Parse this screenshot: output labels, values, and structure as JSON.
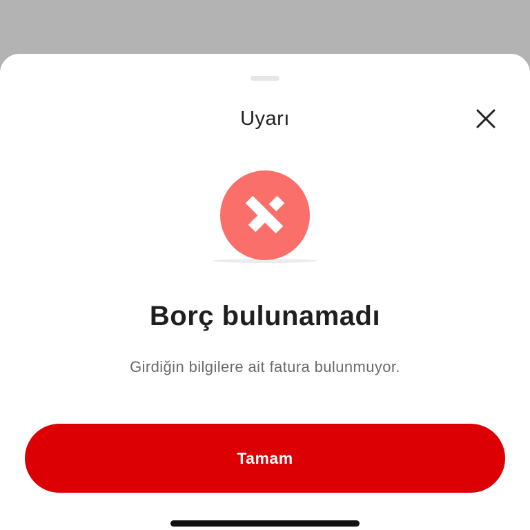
{
  "sheet": {
    "title": "Uyarı",
    "close_icon": "close-icon",
    "status_icon": "error-x-icon"
  },
  "message": {
    "heading": "Borç bulunamadı",
    "description": "Girdiğin bilgilere ait fatura bulunmuyor."
  },
  "actions": {
    "confirm_label": "Tamam"
  },
  "colors": {
    "backdrop": "#b3b3b3",
    "sheet_background": "#ffffff",
    "error_circle": "#fa6f6a",
    "primary_button": "#dc0005",
    "heading_text": "#1f1f1f",
    "description_text": "#6a6a6a"
  }
}
